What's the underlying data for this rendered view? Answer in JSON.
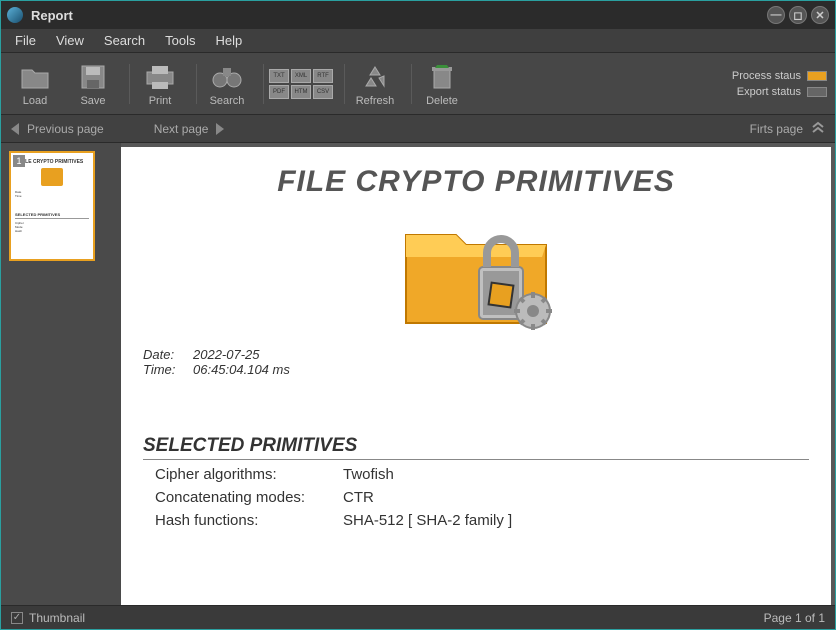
{
  "window": {
    "title": "Report"
  },
  "menu": {
    "file": "File",
    "view": "View",
    "search": "Search",
    "tools": "Tools",
    "help": "Help"
  },
  "toolbar": {
    "load": "Load",
    "save": "Save",
    "print": "Print",
    "search": "Search",
    "refresh": "Refresh",
    "delete": "Delete"
  },
  "filetypes": [
    "TXT",
    "XML",
    "RTF",
    "PDF",
    "HTM",
    "CSV"
  ],
  "status": {
    "process_label": "Process staus",
    "export_label": "Export status",
    "process_color": "#e8a020",
    "export_color": "#666"
  },
  "nav": {
    "prev": "Previous page",
    "next": "Next page",
    "first": "Firts page"
  },
  "thumbnail": {
    "page_number": "1"
  },
  "report": {
    "title": "FILE CRYPTO PRIMITIVES",
    "date_label": "Date:",
    "date_value": "2022-07-25",
    "time_label": "Time:",
    "time_value": "06:45:04.104 ms",
    "section": "SELECTED PRIMITIVES",
    "cipher_label": "Cipher algorithms:",
    "cipher_value": "Twofish",
    "mode_label": "Concatenating modes:",
    "mode_value": "CTR",
    "hash_label": "Hash functions:",
    "hash_value": "SHA-512 [ SHA-2 family ]"
  },
  "statusbar": {
    "thumbnail": "Thumbnail",
    "page_info": "Page 1 of 1"
  }
}
